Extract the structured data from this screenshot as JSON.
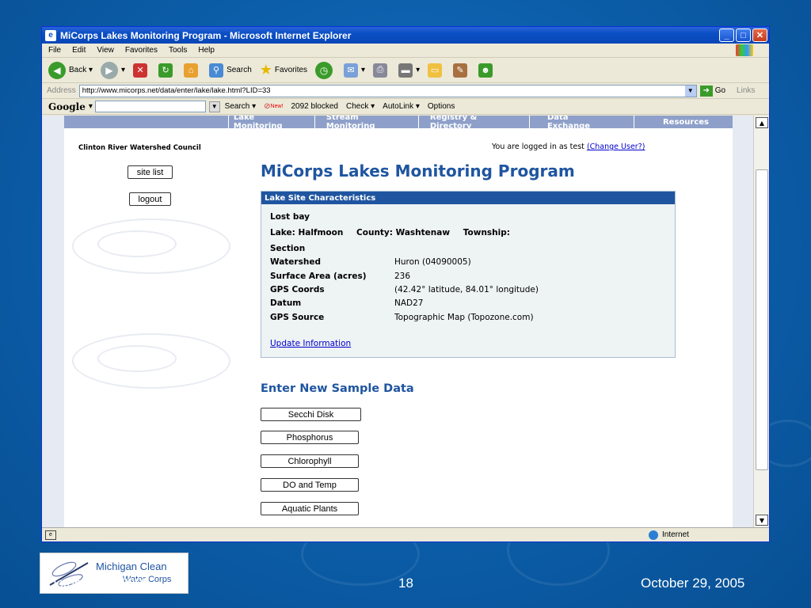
{
  "window": {
    "title": "MiCorps Lakes Monitoring Program - Microsoft Internet Explorer"
  },
  "menu": [
    "File",
    "Edit",
    "View",
    "Favorites",
    "Tools",
    "Help"
  ],
  "toolbar": {
    "back": "Back",
    "search": "Search",
    "favorites": "Favorites"
  },
  "address": {
    "label": "Address",
    "url": "http://www.micorps.net/data/enter/lake/lake.html?LID=33",
    "go": "Go",
    "links": "Links"
  },
  "google_bar": {
    "logo": "Google",
    "search": "Search",
    "new_badge": "New!",
    "blocked": "2092 blocked",
    "check": "Check",
    "autolink": "AutoLink",
    "options": "Options"
  },
  "nav": [
    "Lake Monitoring",
    "Stream Monitoring",
    "Registry & Directory",
    "Data Exchange",
    "Resources"
  ],
  "page": {
    "org": "Clinton River Watershed Council",
    "logged_in": "You are logged in as test",
    "change_user": "(Change User?)",
    "site_list": "site list",
    "logout": "logout",
    "title": "MiCorps Lakes Monitoring Program",
    "panel_title": "Lake Site Characteristics",
    "site_name": "Lost bay",
    "lake_line": "Lake: Halfmoon",
    "county_line": "County: Washtenaw",
    "township_line": "Township:",
    "section_label": "Section",
    "fields": [
      {
        "label": "Watershed",
        "value": "Huron (04090005)"
      },
      {
        "label": "Surface Area (acres)",
        "value": "236"
      },
      {
        "label": "GPS Coords",
        "value": "(42.42° latitude, 84.01° longitude)"
      },
      {
        "label": "Datum",
        "value": "NAD27"
      },
      {
        "label": "GPS Source",
        "value": "Topographic Map (Topozone.com)"
      }
    ],
    "update": "Update Information",
    "sample_title": "Enter New Sample Data",
    "sample_buttons": [
      "Secchi Disk",
      "Phosphorus",
      "Chlorophyll",
      "DO and Temp",
      "Aquatic Plants"
    ]
  },
  "status": {
    "zone": "Internet"
  },
  "slide": {
    "logo_line1": "Michigan Clean",
    "logo_line2": "Water Corps",
    "date_left": "October 29, 2005",
    "page_number": "18",
    "date_right": "October 29, 2005"
  }
}
